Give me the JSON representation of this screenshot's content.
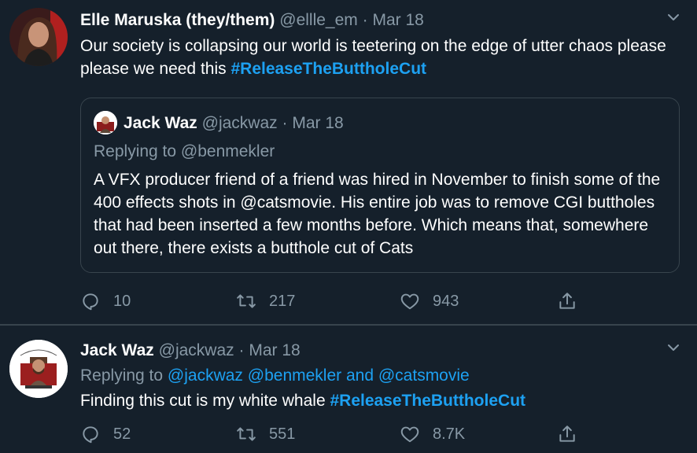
{
  "colors": {
    "background": "#15202b",
    "link": "#1da1f2",
    "muted": "#8899a6",
    "border": "#38444d"
  },
  "tweet1": {
    "author_name": "Elle Maruska (they/them)",
    "handle": "@ellle_em",
    "separator": "·",
    "date": "Mar 18",
    "text": "Our society is collapsing our world is teetering on the edge of utter chaos please please we need this ",
    "hashtag": "#ReleaseTheButtholeCut",
    "quote": {
      "author_name": "Jack Waz",
      "handle": "@jackwaz",
      "separator": "·",
      "date": "Mar 18",
      "replying_prefix": "Replying to ",
      "replying_to": "@benmekler",
      "text_1": "A VFX producer friend of a friend was hired in November to finish some of the 400 effects shots in ",
      "mention": "@catsmovie",
      "text_2": ". His entire job was to remove CGI buttholes that had been inserted a few months before. Which means that, somewhere out there, there exists a butthole cut of Cats"
    },
    "actions": {
      "replies": "10",
      "retweets": "217",
      "likes": "943"
    }
  },
  "tweet2": {
    "author_name": "Jack Waz",
    "handle": "@jackwaz",
    "separator": "·",
    "date": "Mar 18",
    "replying_prefix": "Replying to ",
    "mention_1": "@jackwaz",
    "mention_2": "@benmekler",
    "and": " and ",
    "mention_3": "@catsmovie",
    "text": "Finding this cut is my white whale ",
    "hashtag": "#ReleaseTheButtholeCut",
    "actions": {
      "replies": "52",
      "retweets": "551",
      "likes": "8.7K"
    }
  },
  "icons": [
    "chevron-down-icon",
    "reply-icon",
    "retweet-icon",
    "like-icon",
    "share-icon"
  ]
}
